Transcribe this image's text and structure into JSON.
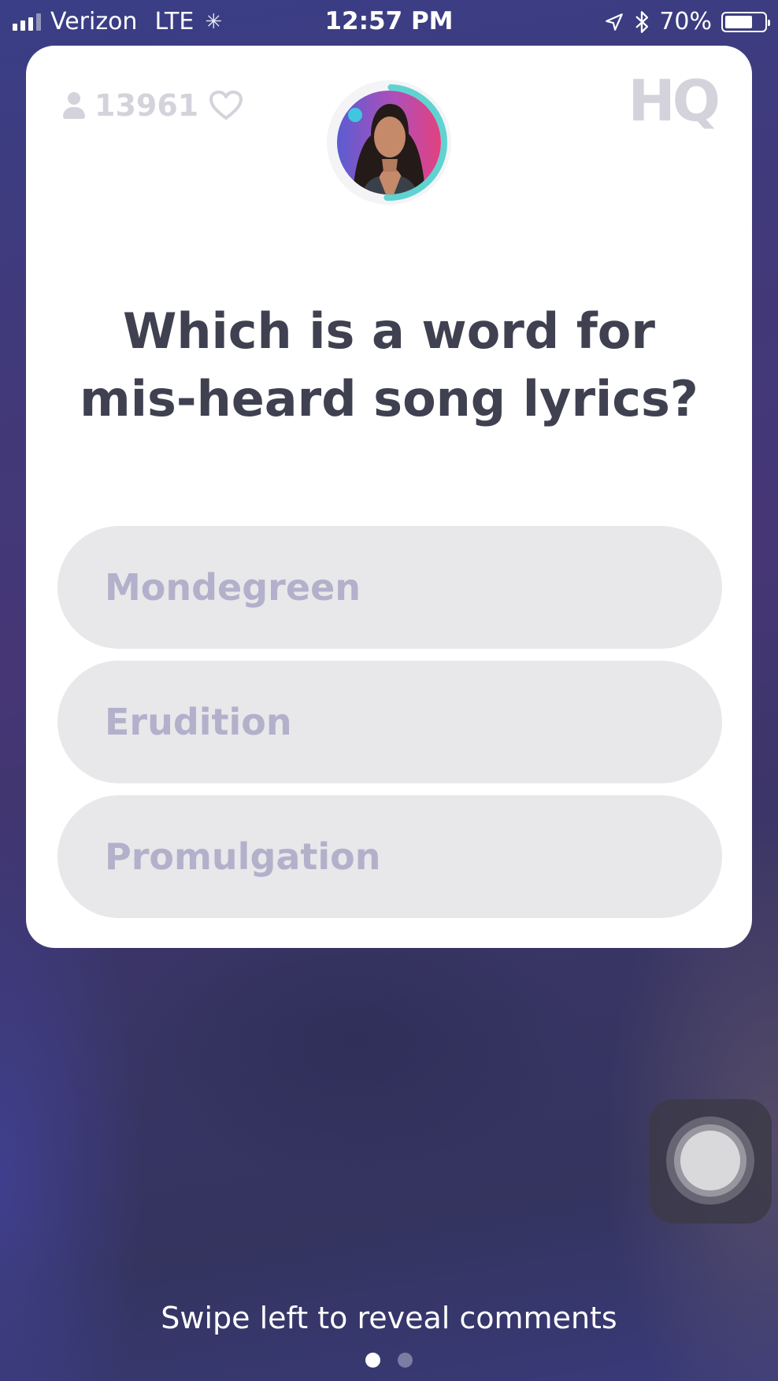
{
  "status_bar": {
    "carrier": "Verizon",
    "network": "LTE",
    "time": "12:57 PM",
    "battery": "70%",
    "battery_level": 0.7,
    "icons": [
      "signal-icon",
      "activity-spinner-icon",
      "location-arrow-icon",
      "bluetooth-icon",
      "battery-icon"
    ]
  },
  "game": {
    "viewer_count": "13961",
    "logo": "HQ",
    "question": "Which is a word for mis-heard song lyrics?",
    "answers": [
      {
        "label": "Mondegreen"
      },
      {
        "label": "Erudition"
      },
      {
        "label": "Promulgation"
      }
    ],
    "icons": [
      "person-icon",
      "heart-icon",
      "host-avatar-timer"
    ]
  },
  "footer": {
    "swipe_hint": "Swipe left to reveal comments",
    "page_count": 2,
    "active_page": 1
  },
  "colors": {
    "card": "#ffffff",
    "question_text": "#3f4050",
    "answer_bg": "#e8e8ea",
    "answer_text": "#b3b0cb",
    "timer_ring": "#5fd3d0",
    "muted_icon": "#d4d3dc"
  }
}
